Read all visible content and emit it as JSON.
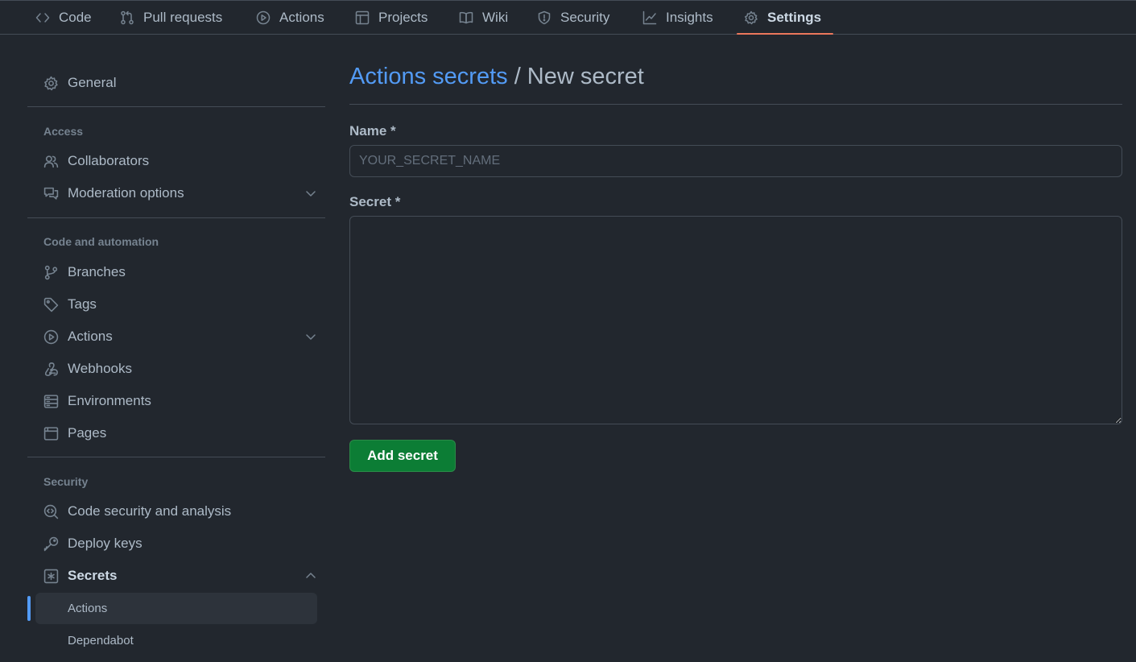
{
  "topnav": {
    "tabs": [
      {
        "label": "Code"
      },
      {
        "label": "Pull requests"
      },
      {
        "label": "Actions"
      },
      {
        "label": "Projects"
      },
      {
        "label": "Wiki"
      },
      {
        "label": "Security"
      },
      {
        "label": "Insights"
      },
      {
        "label": "Settings",
        "active": true
      }
    ],
    "active_color": "#ec775c"
  },
  "sidebar": {
    "general": "General",
    "sections": {
      "access": "Access",
      "code_automation": "Code and automation",
      "security": "Security"
    },
    "items": {
      "collaborators": "Collaborators",
      "moderation": "Moderation options",
      "branches": "Branches",
      "tags": "Tags",
      "actions": "Actions",
      "webhooks": "Webhooks",
      "environments": "Environments",
      "pages": "Pages",
      "code_security": "Code security and analysis",
      "deploy_keys": "Deploy keys",
      "secrets": "Secrets"
    },
    "secrets_sub": [
      {
        "label": "Actions",
        "active": true
      },
      {
        "label": "Dependabot"
      }
    ],
    "accent": "#539bf5"
  },
  "main": {
    "breadcrumb_link": "Actions secrets",
    "breadcrumb_rest": " / New secret",
    "name_label": "Name *",
    "name_placeholder": "YOUR_SECRET_NAME",
    "name_value": "",
    "secret_label": "Secret *",
    "secret_value": "",
    "submit_label": "Add secret",
    "submit_color": "#0c7d35"
  }
}
